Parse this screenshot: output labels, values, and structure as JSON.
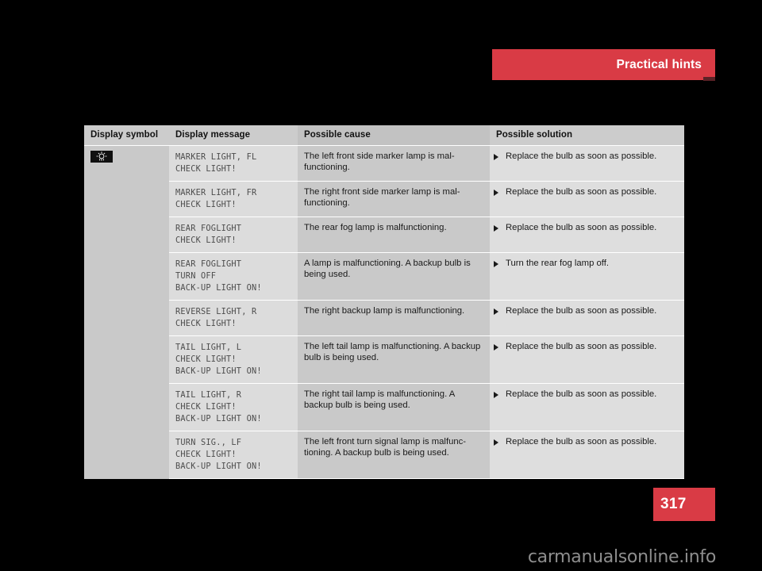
{
  "header": {
    "chapter_label": "Practical hints",
    "accent_color": "#d93b45"
  },
  "page_badge": {
    "number": "317"
  },
  "watermark": {
    "text": "carmanualsonline.info"
  },
  "table": {
    "columns": [
      "Display symbol",
      "Display message",
      "Possible cause",
      "Possible solution"
    ],
    "symbol_icon": "lamp-bulb-indicator-icon",
    "rows": [
      {
        "symbol": "lamp-bulb-indicator-icon",
        "message": "MARKER LIGHT, FL\nCHECK LIGHT!",
        "cause": "The left front side marker lamp is mal-functioning.",
        "solution": "Replace the bulb as soon as possible."
      },
      {
        "symbol": "",
        "message": "MARKER LIGHT, FR\nCHECK LIGHT!",
        "cause": "The right front side marker lamp is mal-functioning.",
        "solution": "Replace the bulb as soon as possible."
      },
      {
        "symbol": "",
        "message": "REAR FOGLIGHT\nCHECK LIGHT!",
        "cause": "The rear fog lamp is malfunctioning.",
        "solution": "Replace the bulb as soon as possible."
      },
      {
        "symbol": "",
        "message": "REAR FOGLIGHT\nTURN OFF\nBACK-UP LIGHT ON!",
        "cause": "A lamp is malfunctioning. A backup bulb is being used.",
        "solution": "Turn the rear fog lamp off."
      },
      {
        "symbol": "",
        "message": "REVERSE LIGHT, R\nCHECK LIGHT!",
        "cause": "The right backup lamp is malfunctioning.",
        "solution": "Replace the bulb as soon as possible."
      },
      {
        "symbol": "",
        "message": "TAIL LIGHT, L\nCHECK LIGHT!\nBACK-UP LIGHT ON!",
        "cause": "The left tail lamp is malfunctioning. A backup bulb is being used.",
        "solution": "Replace the bulb as soon as possible."
      },
      {
        "symbol": "",
        "message": "TAIL LIGHT, R\nCHECK LIGHT!\nBACK-UP LIGHT ON!",
        "cause": "The right tail lamp is malfunctioning. A backup bulb is being used.",
        "solution": "Replace the bulb as soon as possible."
      },
      {
        "symbol": "",
        "message": "TURN SIG., LF\nCHECK LIGHT!\nBACK-UP LIGHT ON!",
        "cause": "The left front turn signal lamp is malfunc-tioning. A backup bulb is being used.",
        "solution": "Replace the bulb as soon as possible."
      }
    ]
  }
}
